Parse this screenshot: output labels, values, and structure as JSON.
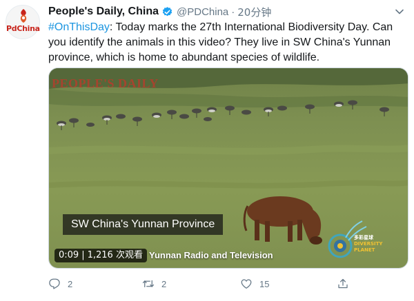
{
  "account": {
    "name": "People's Daily, China",
    "handle": "@PDChina",
    "separator": "·",
    "time": "20分钟",
    "avatar_text": "PdChina"
  },
  "tweet": {
    "hashtag": "#OnThisDay",
    "body": ": Today marks the 27th International Biodiversity Day. Can you identify the animals in this video? They live in SW China's Yunnan province, which is home to abundant species of wildlife."
  },
  "video": {
    "watermark": "PEOPLE'S DAILY",
    "subtitle": "SW China's Yunnan Province",
    "credit": "Yunnan Radio and Television",
    "duration": "0:09",
    "views": "1,216 次观看",
    "logo_text_cn": "多彩星球",
    "logo_text_en": "DIVERSITY PLANET"
  },
  "actions": {
    "replies": "2",
    "retweets": "2",
    "likes": "15"
  },
  "colors": {
    "link": "#1b95e0",
    "secondary_text": "#657786",
    "verified": "#1da1f2",
    "brand_red": "#c8251c"
  },
  "icons": [
    "pdchina-logo-icon",
    "verified-badge-icon",
    "chevron-down-icon",
    "reply-icon",
    "retweet-icon",
    "like-icon",
    "share-icon"
  ]
}
